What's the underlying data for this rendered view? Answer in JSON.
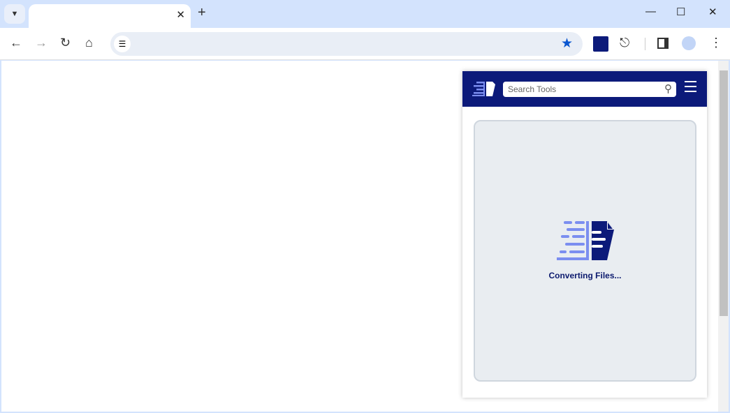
{
  "browser": {
    "tab_title": "",
    "address": "",
    "icons": [
      "tab-search-icon",
      "close-icon",
      "new-tab-icon",
      "minimize-icon",
      "maximize-icon",
      "window-close-icon",
      "back-icon",
      "forward-icon",
      "reload-icon",
      "home-icon",
      "site-settings-icon",
      "bookmark-star-icon",
      "extension-logo-icon",
      "extensions-puzzle-icon",
      "side-panel-icon",
      "profile-icon",
      "menu-dots-icon"
    ],
    "accent": "#0b57d0"
  },
  "popup": {
    "search_placeholder": "Search Tools",
    "status": "Converting Files...",
    "header_color": "#0c1a7a",
    "logo_light": "#7b8ef0",
    "logo_dark": "#0c1a7a"
  }
}
